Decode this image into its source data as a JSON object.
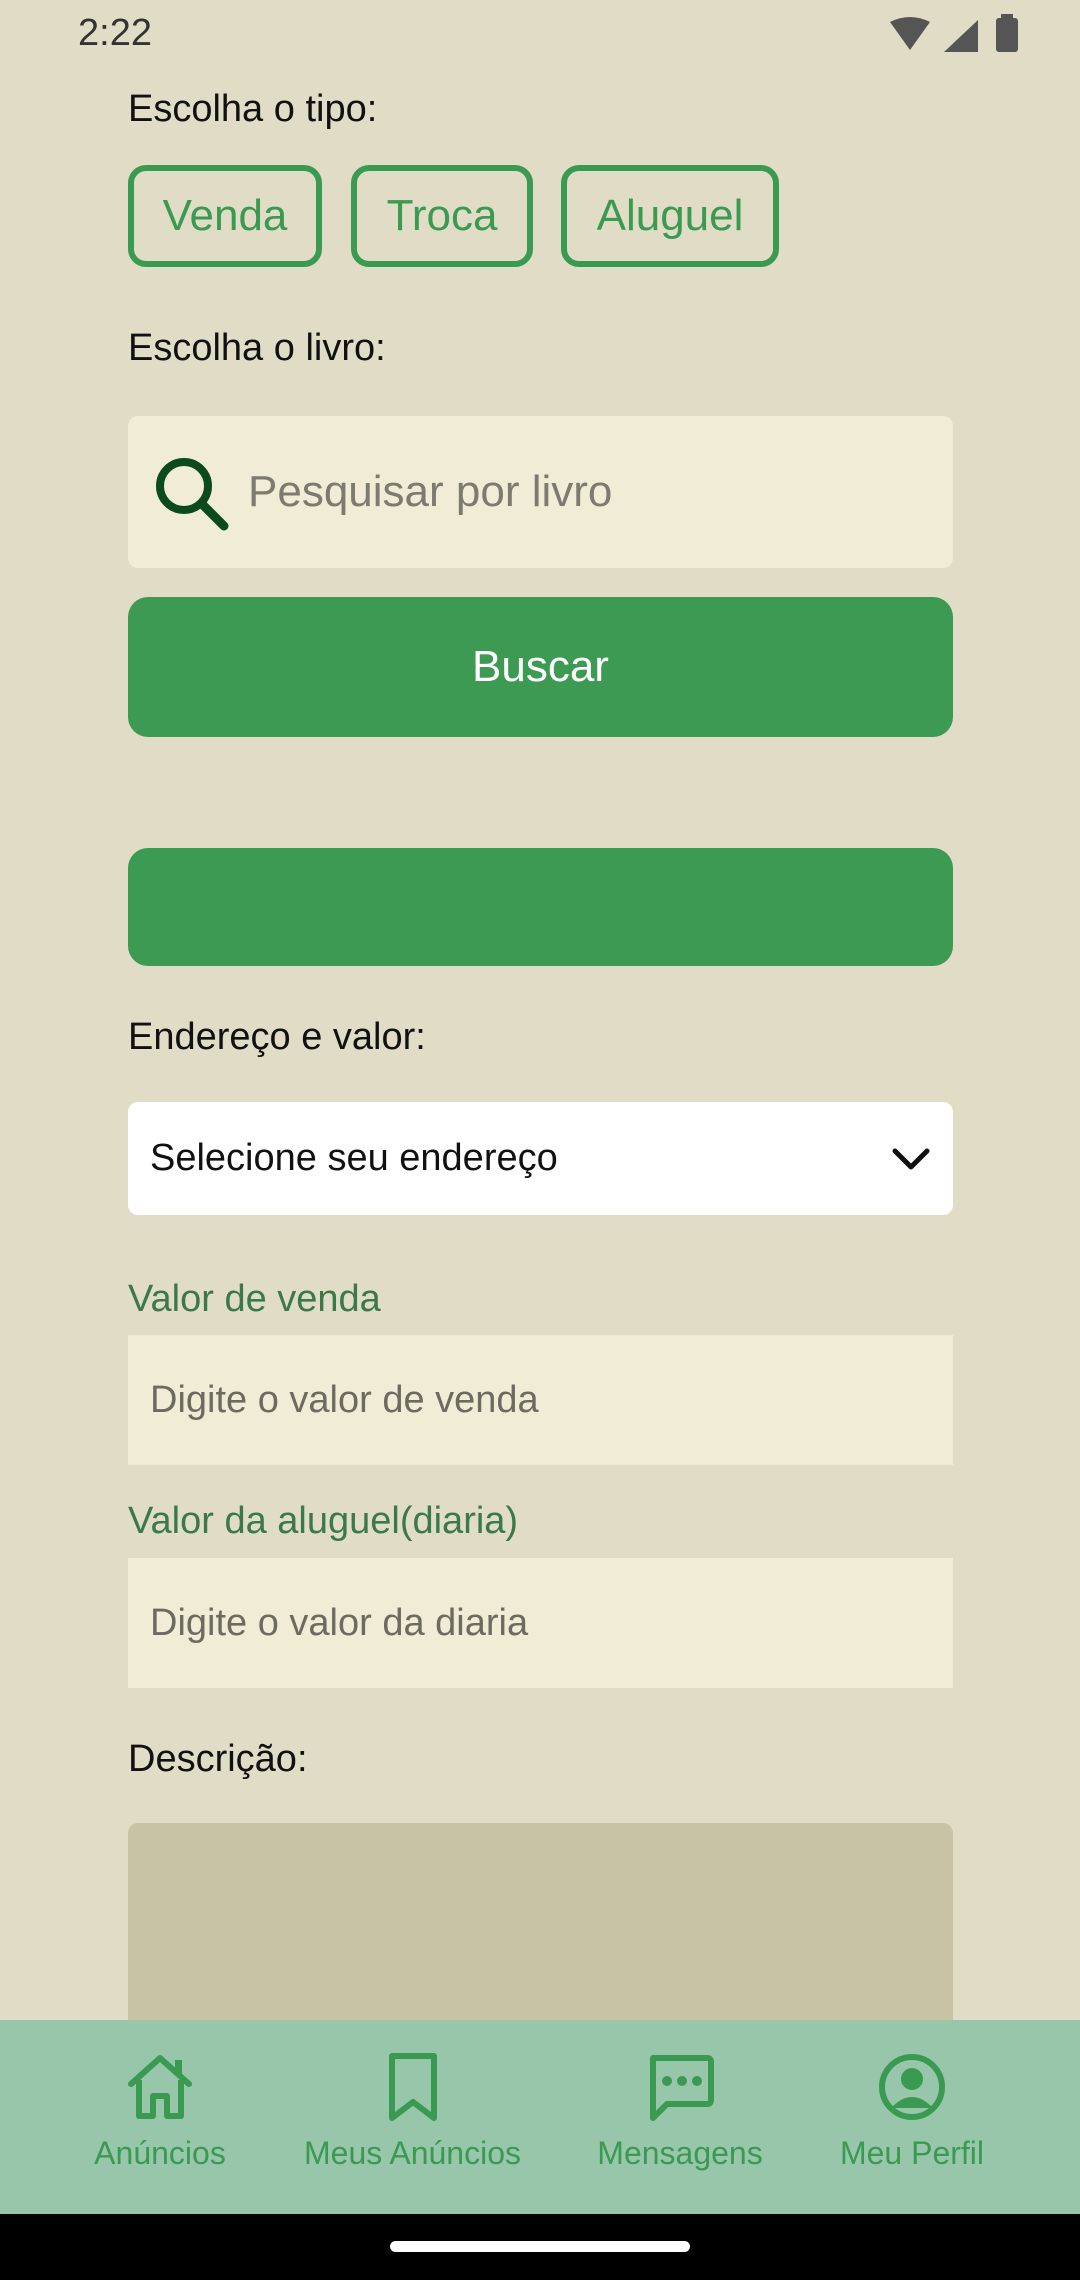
{
  "status": {
    "time": "2:22"
  },
  "tipo": {
    "label": "Escolha o tipo:",
    "options": [
      "Venda",
      "Troca",
      "Aluguel"
    ]
  },
  "livro": {
    "label": "Escolha o livro:",
    "search_placeholder": "Pesquisar por livro",
    "search_button": "Buscar"
  },
  "endereco": {
    "label": "Endereço e valor:",
    "selected": "Selecione seu endereço"
  },
  "venda": {
    "label": "Valor de venda",
    "placeholder": "Digite o valor de venda"
  },
  "aluguel": {
    "label": "Valor da aluguel(diaria)",
    "placeholder": "Digite o valor da diaria"
  },
  "descricao": {
    "label": "Descrição:"
  },
  "nav": {
    "items": [
      {
        "label": "Anúncios",
        "icon": "home-icon"
      },
      {
        "label": "Meus Anúncios",
        "icon": "bookmark-icon"
      },
      {
        "label": "Mensagens",
        "icon": "chat-icon"
      },
      {
        "label": "Meu Perfil",
        "icon": "profile-icon"
      }
    ]
  },
  "colors": {
    "background": "#e0dcc6",
    "accent": "#3d9a52",
    "nav_background": "#97c6ab",
    "input_background": "#f1ecd6"
  }
}
